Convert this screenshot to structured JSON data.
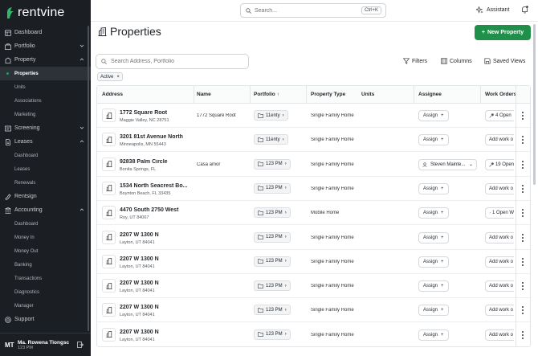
{
  "app": {
    "logo_text": "rentvine"
  },
  "sidebar": {
    "items": [
      {
        "label": "Dashboard",
        "icon": "dashboard-icon"
      },
      {
        "label": "Portfolio",
        "icon": "portfolio-icon",
        "chevron": "down"
      },
      {
        "label": "Property",
        "icon": "property-icon",
        "chevron": "up"
      },
      {
        "label": "Properties",
        "sub": true,
        "active": true
      },
      {
        "label": "Units",
        "sub": true
      },
      {
        "label": "Associations",
        "sub": true
      },
      {
        "label": "Marketing",
        "sub": true
      },
      {
        "label": "Screening",
        "icon": "screening-icon",
        "chevron": "down"
      },
      {
        "label": "Leases",
        "icon": "leases-icon",
        "chevron": "up"
      },
      {
        "label": "Dashboard",
        "sub": true
      },
      {
        "label": "Leases",
        "sub": true
      },
      {
        "label": "Renewals",
        "sub": true
      },
      {
        "label": "Rentsign",
        "icon": "rentsign-icon"
      },
      {
        "label": "Accounting",
        "icon": "accounting-icon",
        "chevron": "up"
      },
      {
        "label": "Dashboard",
        "sub": true
      },
      {
        "label": "Money In",
        "sub": true
      },
      {
        "label": "Money Out",
        "sub": true
      },
      {
        "label": "Banking",
        "sub": true
      },
      {
        "label": "Transactions",
        "sub": true
      },
      {
        "label": "Diagnostics",
        "sub": true
      },
      {
        "label": "Manager",
        "sub": true
      },
      {
        "label": "Support",
        "icon": "support-icon"
      }
    ],
    "user": {
      "initials": "MT",
      "name": "Ma. Rowena Tiongsc",
      "subtitle": "123 PM"
    }
  },
  "topbar": {
    "search_placeholder": "Search...",
    "shortcut": "Ctrl+K",
    "assistant_label": "Assistant"
  },
  "page": {
    "title": "Properties",
    "new_button": "New Property",
    "search_placeholder": "Search Address, Portfolio",
    "filters_label": "Filters",
    "columns_label": "Columns",
    "saved_views_label": "Saved Views",
    "active_filter_chip": "Active",
    "chip_close": "×"
  },
  "table": {
    "columns": [
      "Address",
      "Name",
      "Portfolio",
      "Property Type",
      "Units",
      "Assignee",
      "Work Orders"
    ],
    "rows": [
      {
        "street": "1772 Square Root",
        "city": "Maggie Valley, NC 28751",
        "name": "1772 Square Root",
        "portfolio": "11enty",
        "type": "Single Family Home",
        "assignee": "Assign",
        "work_orders": "4 Open",
        "wo_icon": true
      },
      {
        "street": "3201 81st Avenue North",
        "city": "Minneapolis, MN 55443",
        "name": "",
        "portfolio": "11enty",
        "type": "Single Family Home",
        "assignee": "Assign",
        "work_orders": "Add work o",
        "wo_icon": false
      },
      {
        "street": "92838 Palm Circle",
        "city": "Bonita Springs, FL",
        "name": "Casa amor",
        "portfolio": "123 PM",
        "type": "Single Family Home",
        "assignee": "Steven Mainte...",
        "assignee_person": true,
        "work_orders": "19 Open",
        "wo_icon": true
      },
      {
        "street": "1534 North Seacrest Bo...",
        "city": "Boynton Beach, FL 33435",
        "name": "",
        "portfolio": "123 PM",
        "type": "Single Family Home",
        "assignee": "Assign",
        "work_orders": "Add work o",
        "wo_icon": false
      },
      {
        "street": "4470 South 2750 West",
        "city": "Roy, UT 84067",
        "name": "",
        "portfolio": "123 PM",
        "type": "Mobile Home",
        "assignee": "Assign",
        "work_orders": "1 Open W",
        "wo_icon": true
      },
      {
        "street": "2207 W 1300 N",
        "city": "Layton, UT 84041",
        "name": "",
        "portfolio": "123 PM",
        "type": "Single Family Home",
        "assignee": "Assign",
        "work_orders": "Add work o",
        "wo_icon": false
      },
      {
        "street": "2207 W 1300 N",
        "city": "Layton, UT 84041",
        "name": "",
        "portfolio": "123 PM",
        "type": "Single Family Home",
        "assignee": "Assign",
        "work_orders": "Add work o",
        "wo_icon": false
      },
      {
        "street": "2207 W 1300 N",
        "city": "Layton, UT 84041",
        "name": "",
        "portfolio": "123 PM",
        "type": "Single Family Home",
        "assignee": "Assign",
        "work_orders": "Add work o",
        "wo_icon": false
      },
      {
        "street": "2207 W 1300 N",
        "city": "Layton, UT 84041",
        "name": "",
        "portfolio": "123 PM",
        "type": "Single Family Home",
        "assignee": "Assign",
        "work_orders": "Add work o",
        "wo_icon": false
      },
      {
        "street": "2207 W 1300 N",
        "city": "Layton, UT 84041",
        "name": "",
        "portfolio": "123 PM",
        "type": "Single Family Home",
        "assignee": "Assign",
        "work_orders": "Add work o",
        "wo_icon": false
      }
    ]
  },
  "colors": {
    "sidebar_bg": "#1b1f24",
    "brand_green": "#1f8f4a",
    "active_dot": "#1f9d55"
  }
}
